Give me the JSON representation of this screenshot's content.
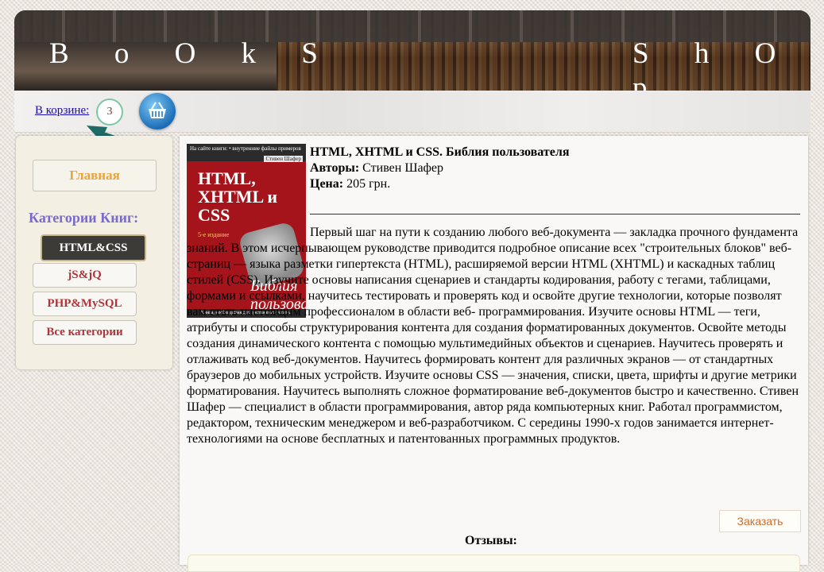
{
  "header": {
    "title_left": "B o O k S",
    "title_right": "S h O p"
  },
  "cart": {
    "link_label": "В корзине:",
    "count": "3",
    "basket_icon": "basket-icon"
  },
  "sidebar": {
    "home_label": "Главная",
    "categories_title": "Категории Книг:",
    "categories": [
      {
        "label": "HTML&CSS",
        "active": true
      },
      {
        "label": "jS&jQ"
      },
      {
        "label": "PHP&MySQL"
      },
      {
        "label": "Все категории"
      }
    ]
  },
  "book": {
    "title": "HTML, XHTML и CSS. Библия пользователя",
    "authors_label": "Авторы:",
    "authors": "Стивен Шафер",
    "price_label": "Цена:",
    "price": "205 грн.",
    "description": "Первый шаг на пути к созданию любого веб-документа — закладка прочного фундамента знаний. В этом исчерпывающем руководстве приводится подробное описание всех \"строительных блоков\" веб-страниц — языка разметки гипертекста (HTML), расширяемой версии HTML (XHTML) и каскадных таблиц стилей (CSS). Изучите основы написания сценариев и стандарты кодирования, работу с тегами, таблицами, формами и ссылками, научитесь тестировать и проверять код и освойте другие технологии, которые позволят вам стать настоящим профессионалом в области веб- программирования. Изучите основы HTML — теги, атрибуты и способы структурирования контента для создания форматированных документов. Освойте методы создания динамического контента с помощью мультимедийных объектов и сценариев. Научитесь проверять и отлаживать код веб-документов. Научитесь формировать контент для различных экранов — от стандартных браузеров до мобильных устройств. Изучите основы CSS — значения, списки, цвета, шрифты и другие метрики форматирования. Научитесь выполнять сложное форматирование веб-документов быстро и качественно. Стивен Шафер — специалист в области программирования, автор ряда компьютерных книг. Работал программистом, редактором, техническим менеджером и веб-разработчиком. С середины 1990-х годов занимается интернет-технологиями на основе бесплатных и патентованных программных продуктов.",
    "order_label": "Заказать"
  },
  "cover": {
    "top_text": "На сайте книги: • внутренние файлы примеров",
    "author": "Стивен Шафер",
    "title": "HTML, XHTML и CSS",
    "edition": "5-е издание",
    "bible": "Библия пользователя",
    "bottom": "Книга, необходимая для достижения успеха!"
  },
  "reviews": {
    "title": "Отзывы:"
  }
}
